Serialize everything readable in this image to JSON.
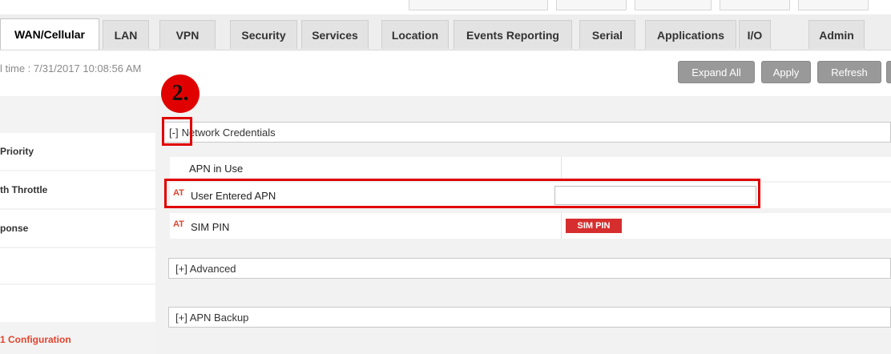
{
  "tabs": [
    {
      "label": "WAN/Cellular",
      "active": true
    },
    {
      "label": "LAN"
    },
    {
      "label": "VPN"
    },
    {
      "label": "Security"
    },
    {
      "label": "Services"
    },
    {
      "label": "Location"
    },
    {
      "label": "Events Reporting"
    },
    {
      "label": "Serial"
    },
    {
      "label": "Applications"
    },
    {
      "label": "I/O"
    },
    {
      "label": "Admin"
    }
  ],
  "toolbar": {
    "time_text": "l time : 7/31/2017 10:08:56 AM",
    "expand_all": "Expand All",
    "apply": "Apply",
    "refresh": "Refresh"
  },
  "sidebar": {
    "items": [
      {
        "label": "Priority"
      },
      {
        "label": "th Throttle"
      },
      {
        "label": "ponse"
      },
      {
        "label": "1 Configuration",
        "color": "#e0442e"
      }
    ]
  },
  "sections": {
    "network_credentials": {
      "toggle": "[-]",
      "label": "Network Credentials",
      "rows": {
        "apn_in_use": {
          "label": "APN in Use",
          "value": ""
        },
        "user_entered_apn": {
          "at": "AT",
          "label": "User Entered APN",
          "value": ""
        },
        "sim_pin": {
          "at": "AT",
          "label": "SIM PIN",
          "badge": "SIM PIN"
        }
      }
    },
    "advanced": {
      "label": "[+] Advanced"
    },
    "apn_backup": {
      "label": "[+] APN Backup"
    }
  },
  "annotation": {
    "step": "2.",
    "color": "#e00000"
  },
  "colors": {
    "accent_red": "#e0442e",
    "button_gray": "#999999",
    "badge_red": "#d62e2e"
  },
  "icons": [
    "toggle-collapse-icon",
    "toggle-expand-icon"
  ]
}
